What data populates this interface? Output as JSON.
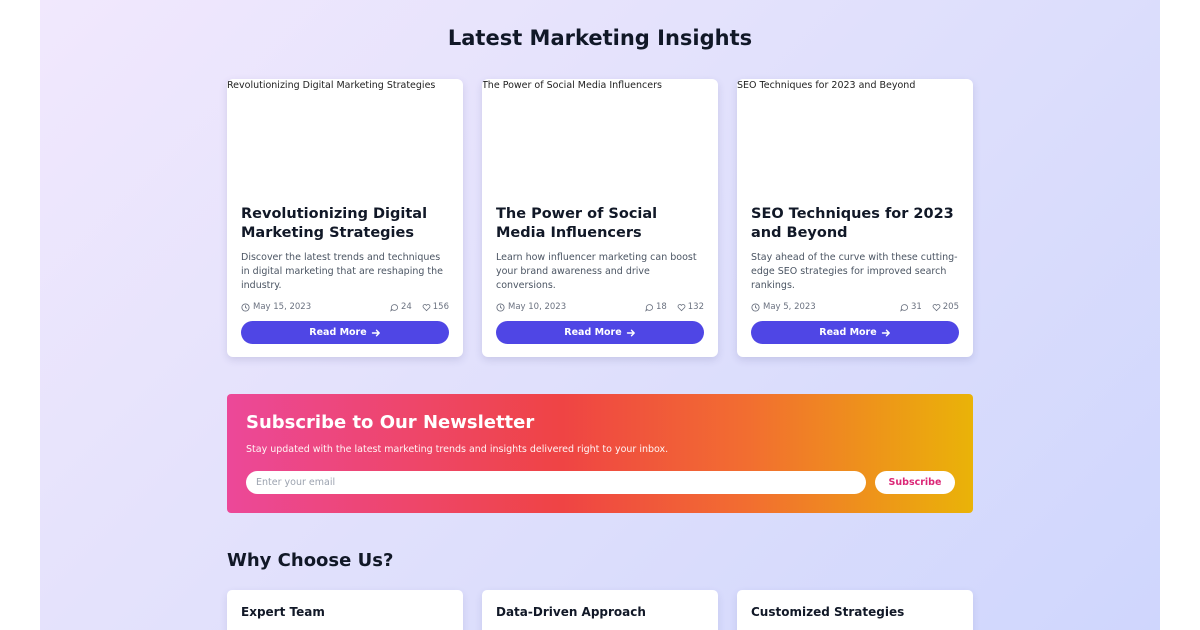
{
  "insights": {
    "heading": "Latest Marketing Insights",
    "posts": [
      {
        "image_alt": "Revolutionizing Digital Marketing Strategies",
        "title": "Revolutionizing Digital Marketing Strategies",
        "description": "Discover the latest trends and techniques in digital marketing that are reshaping the industry.",
        "date": "May 15, 2023",
        "comments": "24",
        "likes": "156",
        "cta": "Read More"
      },
      {
        "image_alt": "The Power of Social Media Influencers",
        "title": "The Power of Social Media Influencers",
        "description": "Learn how influencer marketing can boost your brand awareness and drive conversions.",
        "date": "May 10, 2023",
        "comments": "18",
        "likes": "132",
        "cta": "Read More"
      },
      {
        "image_alt": "SEO Techniques for 2023 and Beyond",
        "title": "SEO Techniques for 2023 and Beyond",
        "description": "Stay ahead of the curve with these cutting-edge SEO strategies for improved search rankings.",
        "date": "May 5, 2023",
        "comments": "31",
        "likes": "205",
        "cta": "Read More"
      }
    ]
  },
  "newsletter": {
    "title": "Subscribe to Our Newsletter",
    "subtitle": "Stay updated with the latest marketing trends and insights delivered right to your inbox.",
    "email_placeholder": "Enter your email",
    "button_label": "Subscribe"
  },
  "why_choose_us": {
    "heading": "Why Choose Us?",
    "features": [
      {
        "title": "Expert Team",
        "description": ""
      },
      {
        "title": "Data-Driven Approach",
        "description": ""
      },
      {
        "title": "Customized Strategies",
        "description": ""
      }
    ]
  },
  "icons": {
    "date": "clock-icon",
    "comments": "comment-icon",
    "likes": "heart-icon",
    "cta": "arrow-right-icon"
  },
  "colors": {
    "primary_button": "#4f46e5",
    "newsletter_gradient": [
      "#ec4899",
      "#ef4444",
      "#eab308"
    ],
    "subscribe_text": "#db2777"
  }
}
